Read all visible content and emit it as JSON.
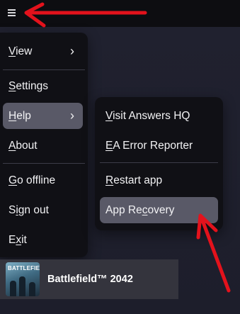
{
  "titlebar": {
    "menu_icon": "hamburger-menu-icon"
  },
  "menu": {
    "items": [
      {
        "label": "View",
        "mnemonic": "V",
        "has_submenu": true
      },
      {
        "label": "Settings",
        "mnemonic": "S"
      },
      {
        "label": "Help",
        "mnemonic": "H",
        "has_submenu": true,
        "active": true
      },
      {
        "label": "About",
        "mnemonic": "A"
      },
      {
        "label": "Go offline",
        "mnemonic": "G"
      },
      {
        "label": "Sign out",
        "mnemonic": "i"
      },
      {
        "label": "Exit",
        "mnemonic": "x"
      }
    ]
  },
  "help_submenu": {
    "items": [
      {
        "label": "Visit Answers HQ",
        "mnemonic": "V"
      },
      {
        "label": "EA Error Reporter",
        "mnemonic": "E"
      },
      {
        "label": "Restart app",
        "mnemonic": "R"
      },
      {
        "label": "App Recovery",
        "mnemonic": "c",
        "highlighted": true
      }
    ]
  },
  "game": {
    "title": "Battlefield™ 2042",
    "cover_text": "BATTLEFIELD"
  },
  "annotations": {
    "arrow_color": "#e3121c"
  },
  "colors": {
    "menu_bg": "#101015",
    "active_item_bg": "#595967",
    "app_bg": "#1e1f2c"
  }
}
